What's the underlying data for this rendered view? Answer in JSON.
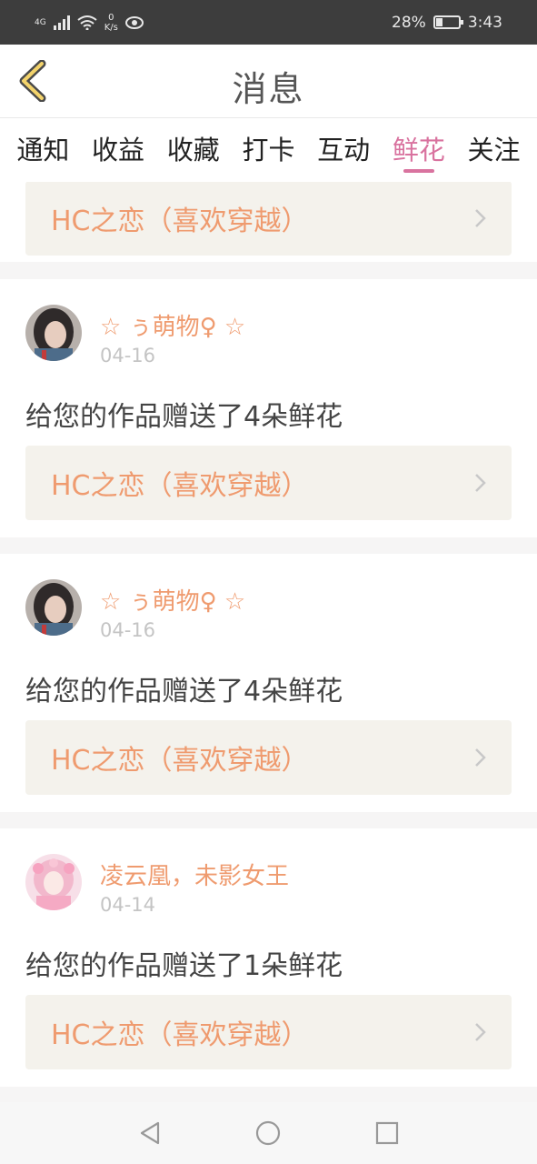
{
  "status_bar": {
    "network": "4G",
    "speed_value": "0",
    "speed_unit": "K/s",
    "battery": "28%",
    "time": "3:43",
    "battery_level": 0.28
  },
  "header": {
    "title": "消息"
  },
  "tabs": [
    {
      "label": "通知",
      "active": false
    },
    {
      "label": "收益",
      "active": false
    },
    {
      "label": "收藏",
      "active": false
    },
    {
      "label": "打卡",
      "active": false
    },
    {
      "label": "互动",
      "active": false
    },
    {
      "label": "鲜花",
      "active": true
    },
    {
      "label": "关注",
      "active": false
    }
  ],
  "partial_card": {
    "work_title": "HC之恋（喜欢穿越）"
  },
  "cards": [
    {
      "username": "☆ ぅ萌物♀ ☆",
      "date": "04-16",
      "message": "给您的作品赠送了4朵鲜花",
      "work_title": "HC之恋（喜欢穿越）"
    },
    {
      "username": "☆ ぅ萌物♀ ☆",
      "date": "04-16",
      "message": "给您的作品赠送了4朵鲜花",
      "work_title": "HC之恋（喜欢穿越）"
    },
    {
      "username": "凌云凰，未影女王",
      "date": "04-14",
      "message": "给您的作品赠送了1朵鲜花",
      "work_title": "HC之恋（喜欢穿越）"
    }
  ],
  "colors": {
    "accent_pink": "#d9739f",
    "accent_orange": "#ef9b6f",
    "work_box_bg": "#f4f2ec"
  }
}
